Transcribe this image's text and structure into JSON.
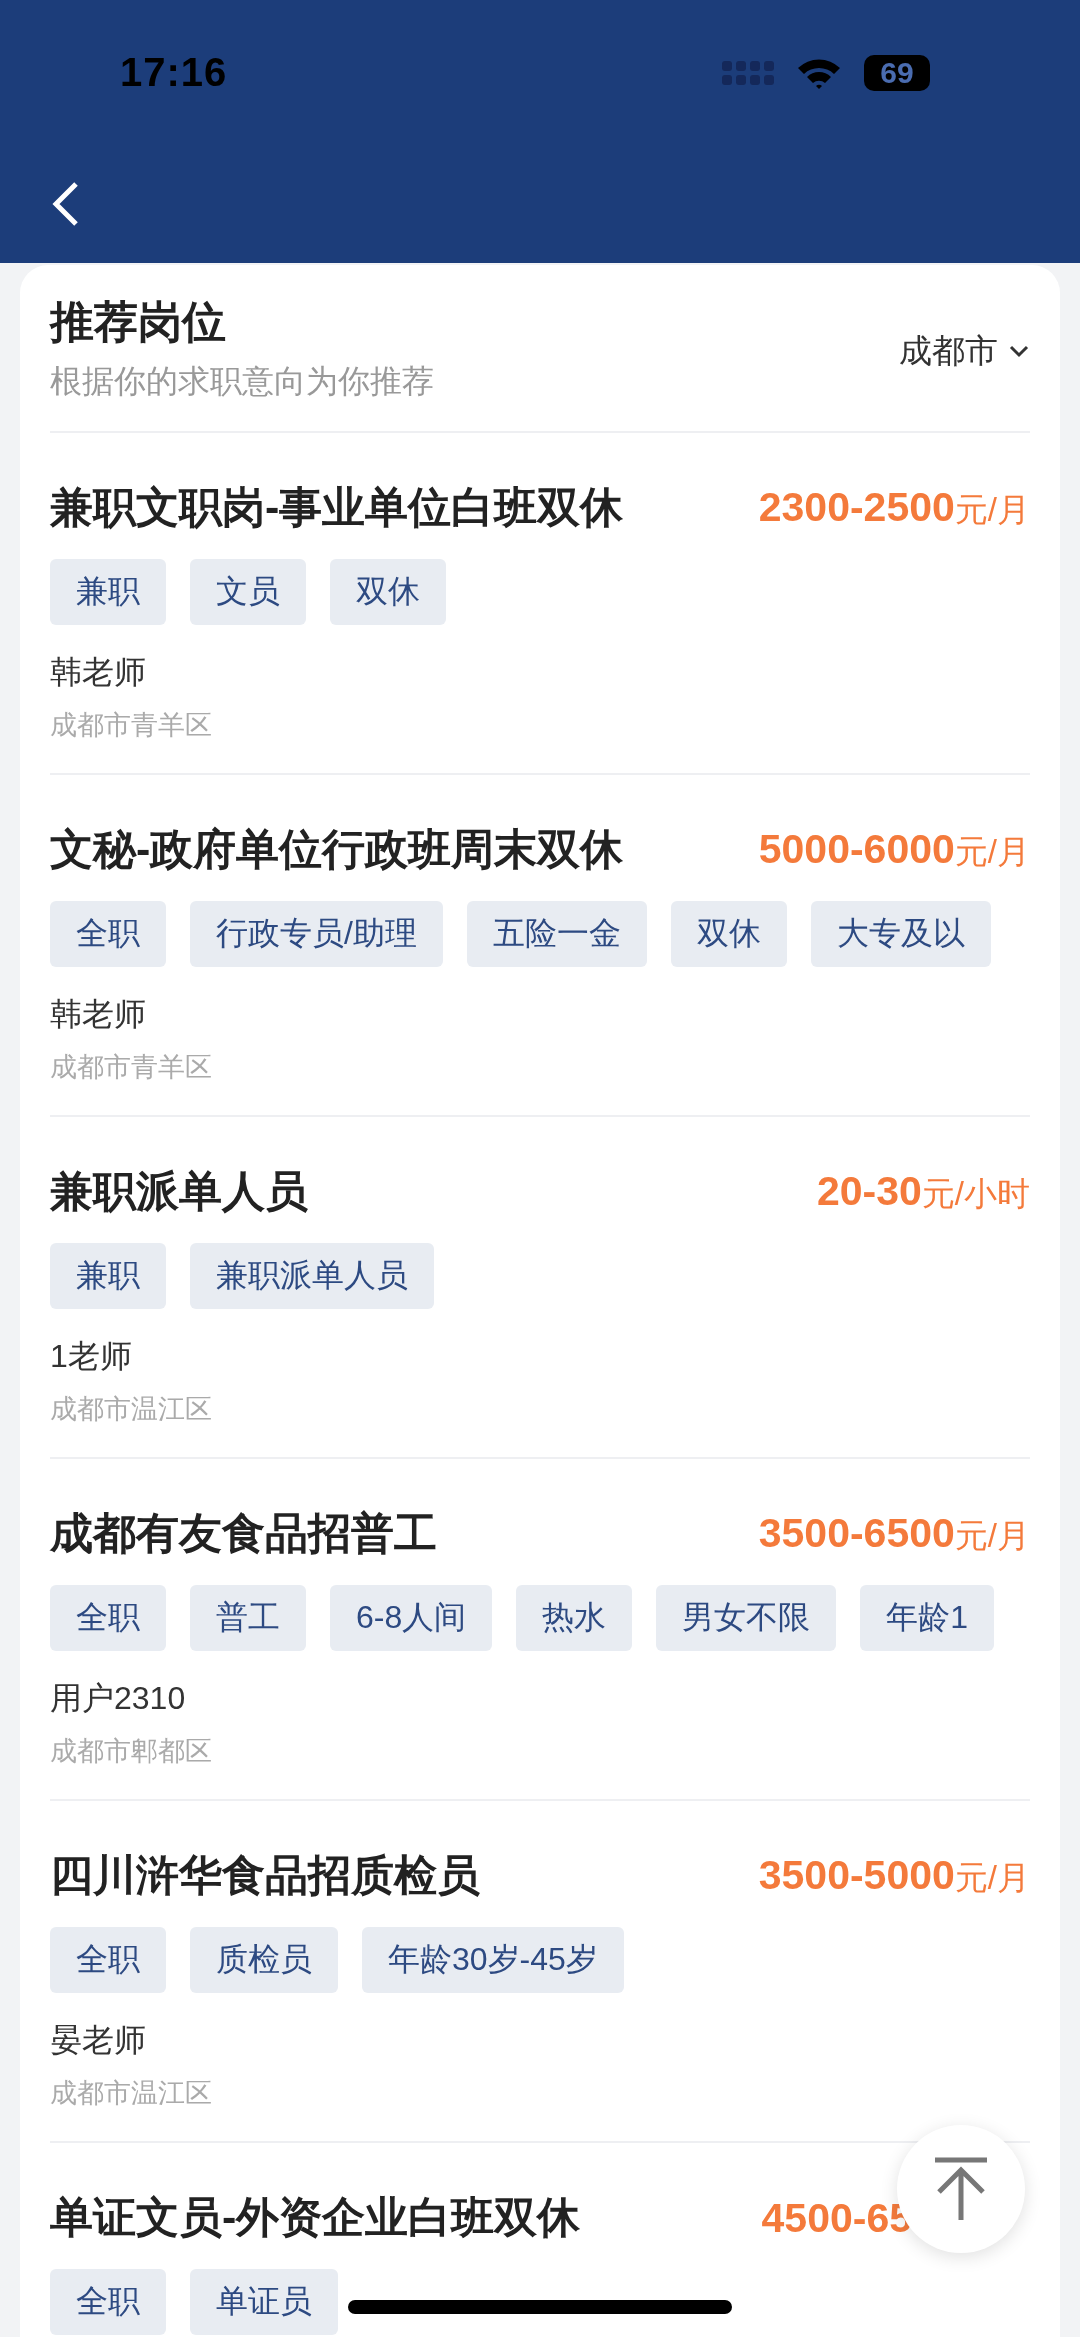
{
  "status_bar": {
    "time": "17:16",
    "battery": "69"
  },
  "section": {
    "title": "推荐岗位",
    "subtitle": "根据你的求职意向为你推荐",
    "city": "成都市"
  },
  "jobs": [
    {
      "title": "兼职文职岗-事业单位白班双休",
      "salary": {
        "amount": "2300-2500",
        "unit": "元/月"
      },
      "tags": [
        "兼职",
        "文员",
        "双休"
      ],
      "recruiter": "韩老师",
      "location": "成都市青羊区"
    },
    {
      "title": "文秘-政府单位行政班周末双休",
      "salary": {
        "amount": "5000-6000",
        "unit": "元/月"
      },
      "tags": [
        "全职",
        "行政专员/助理",
        "五险一金",
        "双休",
        "大专及以"
      ],
      "recruiter": "韩老师",
      "location": "成都市青羊区"
    },
    {
      "title": "兼职派单人员",
      "salary": {
        "amount": "20-30",
        "unit": "元/小时"
      },
      "tags": [
        "兼职",
        "兼职派单人员"
      ],
      "recruiter": "1老师",
      "location": "成都市温江区"
    },
    {
      "title": "成都有友食品招普工",
      "salary": {
        "amount": "3500-6500",
        "unit": "元/月"
      },
      "tags": [
        "全职",
        "普工",
        "6-8人间",
        "热水",
        "男女不限",
        "年龄1"
      ],
      "recruiter": "用户2310",
      "location": "成都市郫都区"
    },
    {
      "title": "四川浒华食品招质检员",
      "salary": {
        "amount": "3500-5000",
        "unit": "元/月"
      },
      "tags": [
        "全职",
        "质检员",
        "年龄30岁-45岁"
      ],
      "recruiter": "晏老师",
      "location": "成都市温江区"
    },
    {
      "title": "单证文员-外资企业白班双休",
      "salary": {
        "amount": "4500-65"
      },
      "tags": [
        "全职",
        "单证员"
      ]
    }
  ]
}
